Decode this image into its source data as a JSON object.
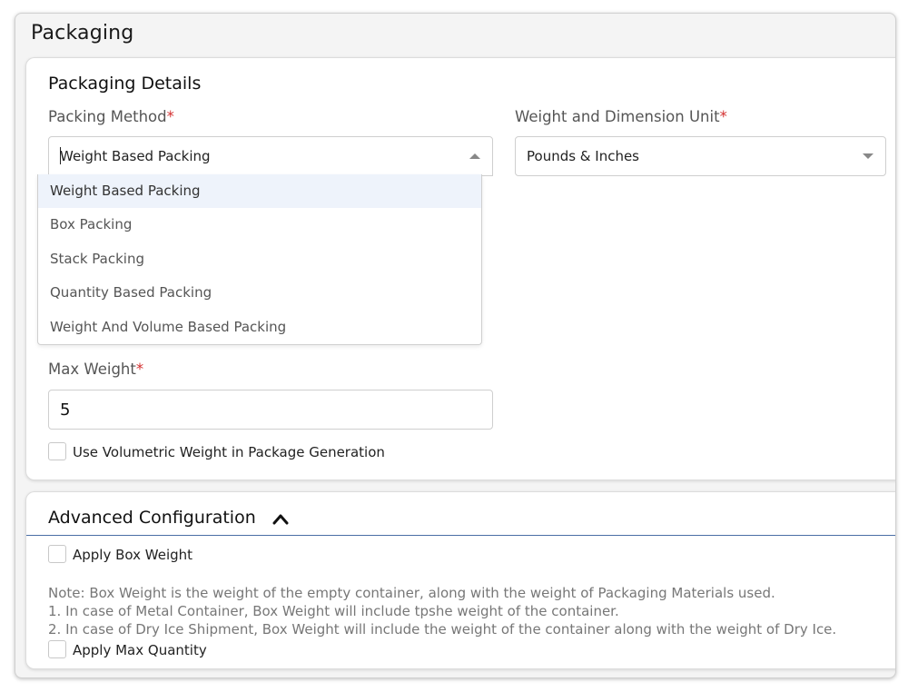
{
  "panel": {
    "title": "Packaging"
  },
  "details": {
    "title": "Packaging Details",
    "packing_method": {
      "label": "Packing Method",
      "required_mark": "*",
      "value": "Weight Based Packing",
      "options": [
        "Weight Based Packing",
        "Box Packing",
        "Stack Packing",
        "Quantity Based Packing",
        "Weight And Volume Based Packing"
      ],
      "selected_index": 0
    },
    "unit": {
      "label": "Weight and Dimension Unit",
      "required_mark": "*",
      "value": "Pounds & Inches"
    },
    "max_weight": {
      "label": "Max Weight",
      "required_mark": "*",
      "value": "5"
    },
    "volumetric_checkbox": {
      "label": "Use Volumetric Weight in Package Generation",
      "checked": false
    }
  },
  "advanced": {
    "title": "Advanced Configuration",
    "apply_box_weight": {
      "label": "Apply Box Weight",
      "checked": false
    },
    "note_lines": [
      "Note: Box Weight is the weight of the empty container, along with the weight of Packaging Materials used.",
      "1. In case of Metal Container, Box Weight will include tpshe weight of the container.",
      "2. In case of Dry Ice Shipment, Box Weight will include the weight of the container along with the weight of Dry Ice."
    ],
    "apply_max_quantity": {
      "label": "Apply Max Quantity",
      "checked": false
    }
  },
  "icons": {
    "dropdown_open": "caret-up-icon",
    "dropdown_closed": "caret-down-icon",
    "collapse": "chevron-up-icon"
  },
  "colors": {
    "required": "#d32f2f",
    "option_highlight": "#eef3fb",
    "divider_accent": "#4a6fa5"
  }
}
